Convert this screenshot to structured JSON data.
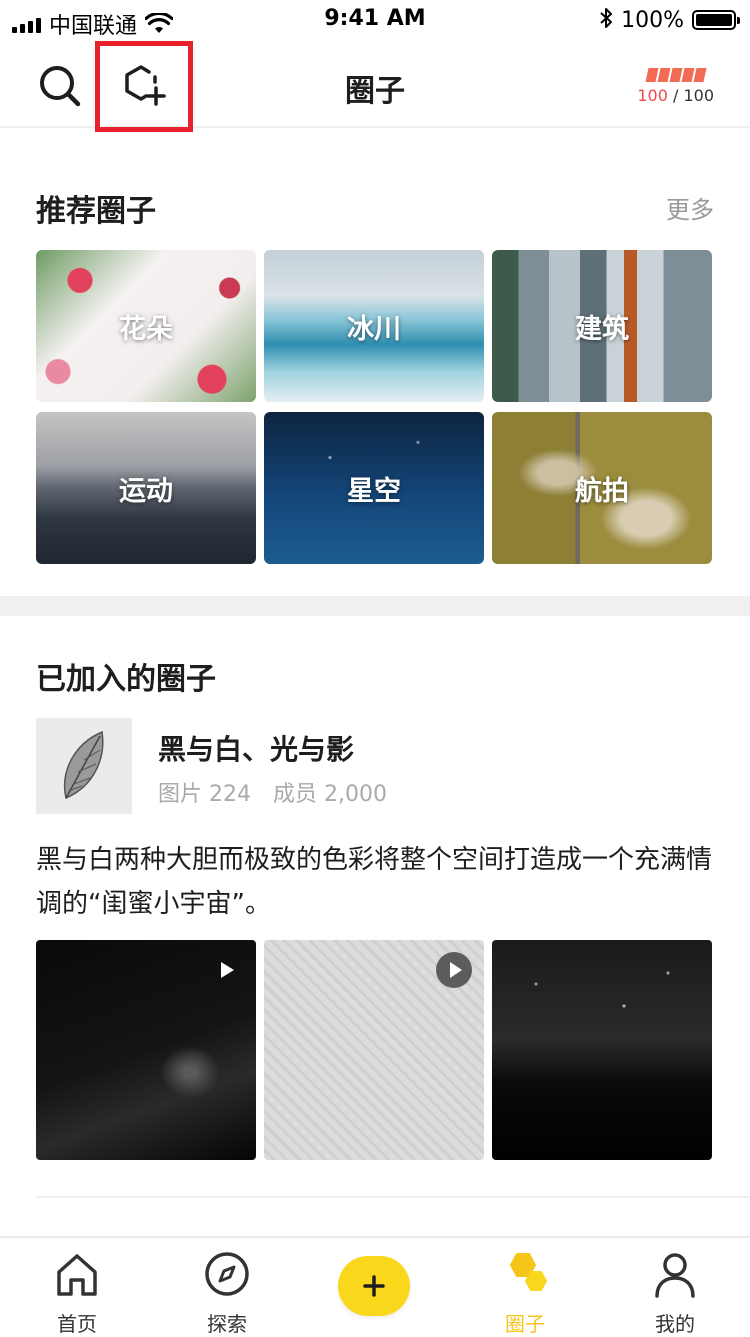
{
  "status_bar": {
    "carrier": "中国联通",
    "time": "9:41 AM",
    "battery": "100%"
  },
  "nav": {
    "title": "圈子",
    "energy_current": "100",
    "energy_separator": " / ",
    "energy_total": "100",
    "energy_color": "#f26b55"
  },
  "recommended": {
    "title": "推荐圈子",
    "more": "更多",
    "circles": [
      {
        "label": "花朵"
      },
      {
        "label": "冰川"
      },
      {
        "label": "建筑"
      },
      {
        "label": "运动"
      },
      {
        "label": "星空"
      },
      {
        "label": "航拍"
      }
    ]
  },
  "joined": {
    "title": "已加入的圈子",
    "card": {
      "name": "黑与白、光与影",
      "photos": "图片 224",
      "members": "成员 2,000",
      "description": "黑与白两种大胆而极致的色彩将整个空间打造成一个充满情调的“闺蜜小宇宙”。",
      "media": [
        {
          "kind": "video"
        },
        {
          "kind": "video"
        },
        {
          "kind": "photo"
        }
      ]
    }
  },
  "tab_bar": {
    "accent_color": "#f5c518",
    "tabs": [
      {
        "label": "首页",
        "icon": "home-icon"
      },
      {
        "label": "探索",
        "icon": "compass-icon"
      },
      {
        "label": "",
        "icon": "plus-icon"
      },
      {
        "label": "圈子",
        "icon": "hexagons-icon",
        "active": true
      },
      {
        "label": "我的",
        "icon": "person-icon"
      }
    ]
  }
}
